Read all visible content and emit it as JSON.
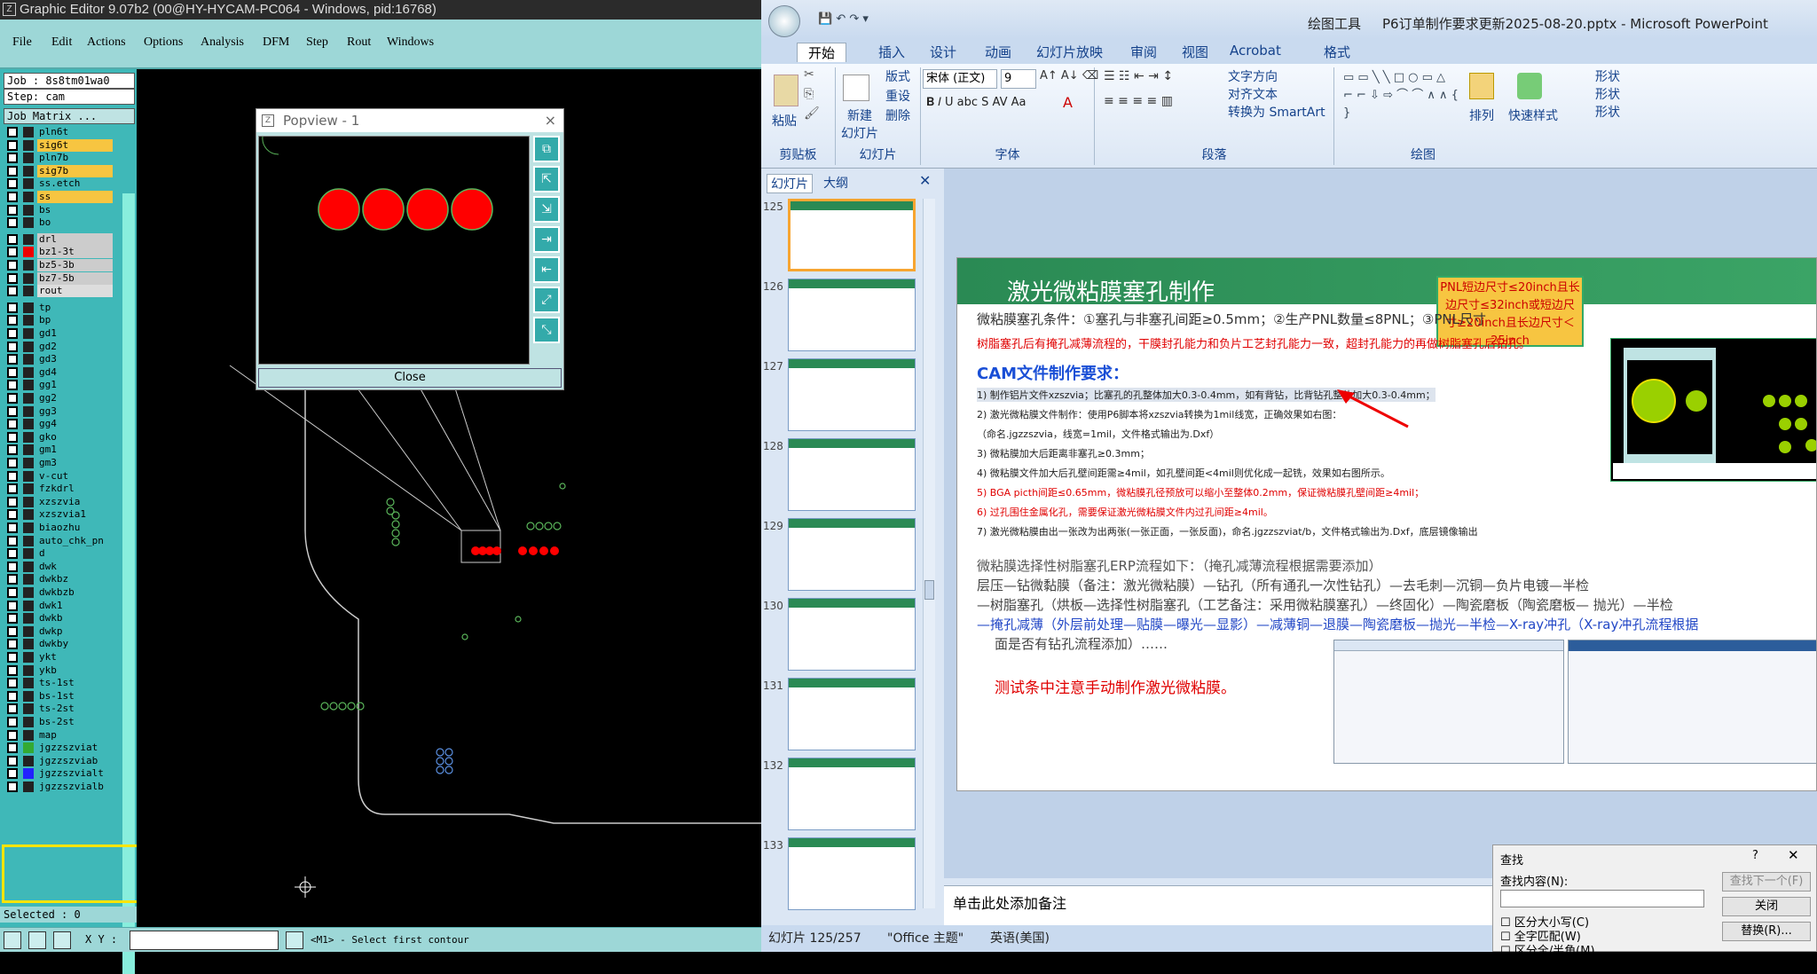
{
  "ge": {
    "title": "Graphic Editor 9.07b2 (00@HY-HYCAM-PC064 - Windows, pid:16768)",
    "menu": [
      "File",
      "Edit",
      "Actions",
      "Options",
      "Analysis",
      "DFM",
      "Step",
      "Rout",
      "Windows"
    ],
    "job": "Job : 8s8tm01wa0",
    "step": "Step: cam",
    "job_matrix": "Job Matrix ...",
    "layers": [
      "pln6t",
      "sig6t",
      "pln7b",
      "sig7b",
      "ss.etch",
      "ss",
      "bs",
      "bo",
      "drl",
      "bz1-3t",
      "bz5-3b",
      "bz7-5b",
      "rout",
      "tp",
      "bp",
      "gd1",
      "gd2",
      "gd3",
      "gd4",
      "gg1",
      "gg2",
      "gg3",
      "gg4",
      "gko",
      "gm1",
      "gm3",
      "v-cut",
      "fzkdrl",
      "xzszvia",
      "xzszvia1",
      "biaozhu",
      "auto_chk_pn",
      "d",
      "dwk",
      "dwkbz",
      "dwkbzb",
      "dwk1",
      "dwkb",
      "dwkp",
      "dwkby",
      "ykt",
      "ykb",
      "ts-1st",
      "bs-1st",
      "ts-2st",
      "bs-2st",
      "map",
      "jgzzszviat",
      "jgzzszviab",
      "jgzzszvialt",
      "jgzzszvialb"
    ],
    "selected": "Selected : 0",
    "xy_label": "X Y :",
    "status_msg": "<M1> - Select first contour",
    "popview_title": "Popview - 1",
    "popview_close": "Close",
    "colors": {
      "highlight": "#f7c541",
      "accent": "#3fb8b8",
      "pad": "#ff0000",
      "yellow_box": "#ffe400"
    }
  },
  "pp": {
    "title_tools": "绘图工具",
    "title": "P6订单制作要求更新2025-08-20.pptx - Microsoft PowerPoint",
    "tabs": [
      "开始",
      "插入",
      "设计",
      "动画",
      "幻灯片放映",
      "审阅",
      "视图",
      "Acrobat",
      "格式"
    ],
    "ribbon": {
      "paste": "粘贴",
      "clipboard": "剪贴板",
      "new_slide": "新建\n幻灯片",
      "layout": "版式",
      "reset": "重设",
      "delete": "删除",
      "slides": "幻灯片",
      "font_name": "宋体 (正文)",
      "font_size": "9",
      "font": "字体",
      "text_dir": "文字方向",
      "align_text": "对齐文本",
      "smartart": "转换为 SmartArt",
      "paragraph": "段落",
      "arrange": "排列",
      "quick_styles": "快速样式",
      "shape_fill": "形状",
      "drawing": "绘图"
    },
    "panel_tabs": [
      "幻灯片",
      "大纲"
    ],
    "thumb_nums": [
      "125",
      "126",
      "127",
      "128",
      "129",
      "130",
      "131",
      "132",
      "133"
    ],
    "slide": {
      "heading": "激光微粘膜塞孔制作",
      "callout": "PNL短边尺寸≤20inch且长边尺寸≤32inch或短边尺寸≥20inch且长边尺寸＜25inch",
      "line1": "微粘膜塞孔条件：①塞孔与非塞孔间距≥0.5mm；②生产PNL数量≤8PNL；③PNL尺寸",
      "line2": "树脂塞孔后有掩孔减薄流程的，干膜封孔能力和负片工艺封孔能力一致，超封孔能力的再做树脂塞孔后钻孔。",
      "cam_title": "CAM文件制作要求：",
      "req1": "1) 制作铝片文件xzszvia；比塞孔的孔整体加大0.3-0.4mm，如有背钻，比背钻孔整体加大0.3-0.4mm；",
      "req2": "2) 激光微粘膜文件制作：使用P6脚本将xzszvia转换为1mil线宽，正确效果如右图：",
      "req2b": "（命名.jgzzszvia，线宽=1mil，文件格式输出为.Dxf）",
      "req3": "3) 微粘膜加大后距离非塞孔≥0.3mm；",
      "req4": "4) 微粘膜文件加大后孔壁间距需≥4mil，如孔壁间距<4mil则优化成一起铣，效果如右图所示。",
      "req5": "5)  BGA picth间距≤0.65mm，微粘膜孔径预放可以缩小至整体0.2mm，保证微粘膜孔壁间距≥4mil；",
      "req6": "6) 过孔围住金属化孔，需要保证激光微粘膜文件内过孔间距≥4mil。",
      "req7": "7) 激光微粘膜由出一张改为出两张(一张正面，一张反面)，命名.jgzzszviat/b，文件格式输出为.Dxf，底层镜像输出",
      "erp_title": "微粘膜选择性树脂塞孔ERP流程如下：（掩孔减薄流程根据需要添加）",
      "erp1": "层压—钻微黏膜（备注：激光微粘膜）—钻孔（所有通孔一次性钻孔）—去毛刺—沉铜—负片电镀—半检",
      "erp2": "—树脂塞孔（烘板—选择性树脂塞孔（工艺备注：采用微粘膜塞孔）—终固化）—陶瓷磨板（陶瓷磨板— 抛光）—半检",
      "erp3": "—掩孔减薄（外层前处理—贴膜—曝光—显影）—减薄铜—退膜—陶瓷磨板—抛光—半检—X-ray冲孔（X-ray冲孔流程根据",
      "erp4": "面是否有钻孔流程添加）……",
      "test_note": "测试条中注意手动制作激光微粘膜。"
    },
    "notes_placeholder": "单击此处添加备注",
    "status": {
      "slide_info": "幻灯片 125/257",
      "theme": "\"Office 主题\"",
      "lang": "英语(美国)"
    },
    "find": {
      "title": "查找",
      "content_label": "查找内容(N):",
      "find_next": "查找下一个(F)",
      "close": "关闭",
      "replace": "替换(R)...",
      "opt1": "区分大小写(C)",
      "opt2": "全字匹配(W)",
      "opt3": "区分全/半角(M)"
    }
  }
}
